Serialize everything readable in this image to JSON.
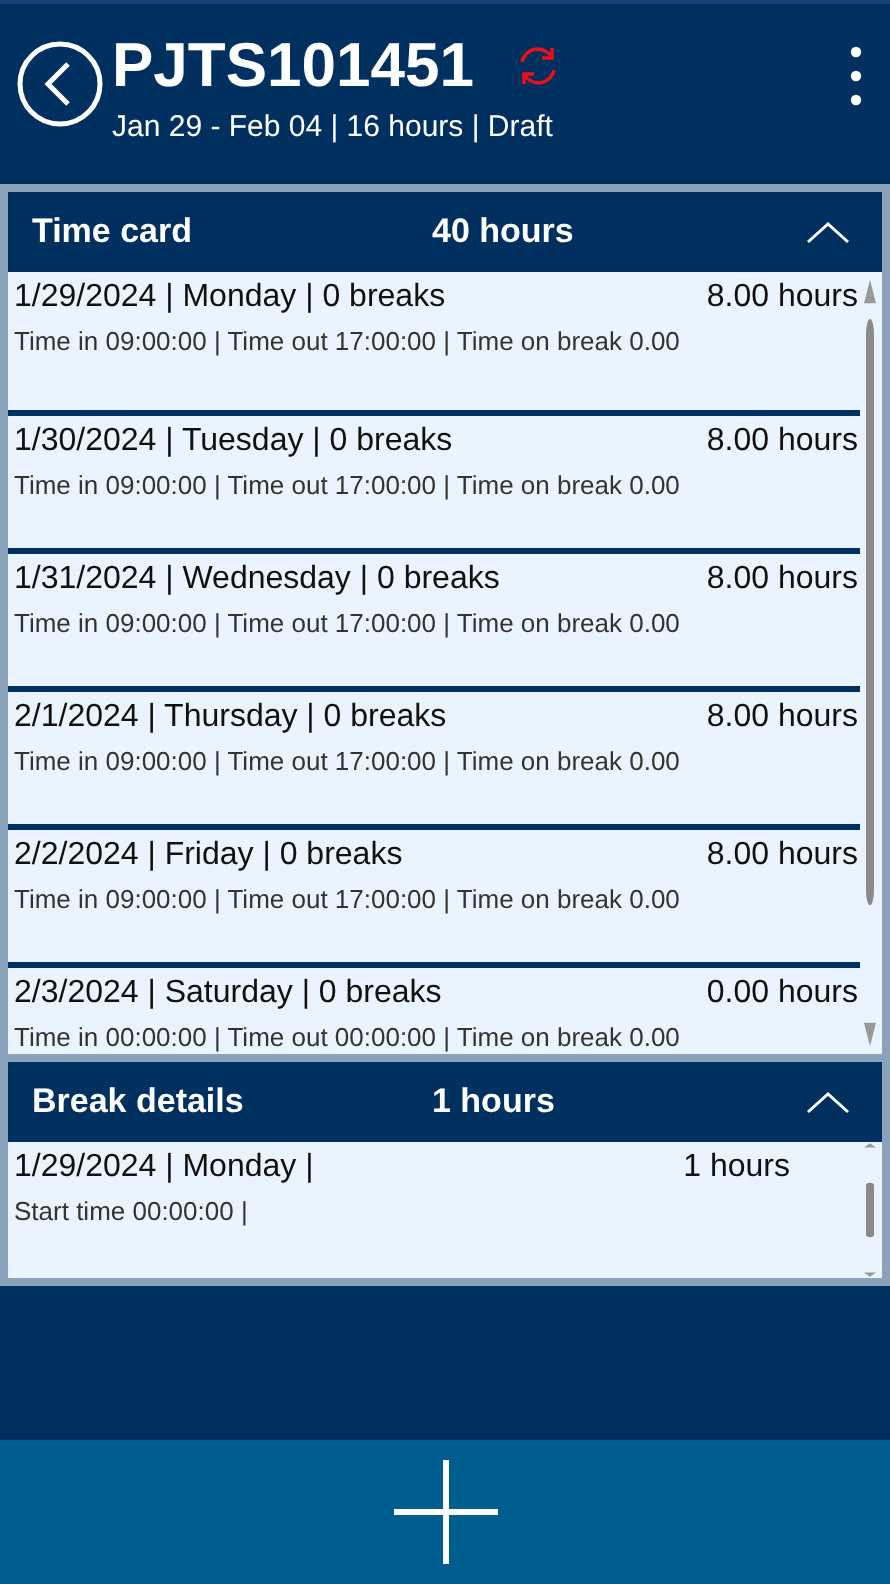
{
  "header": {
    "title": "PJTS101451",
    "subtitle": "Jan 29 - Feb 04 | 16 hours | Draft"
  },
  "time_card": {
    "title": "Time card",
    "total": "40 hours",
    "expanded": true,
    "rows": [
      {
        "line1": "1/29/2024 | Monday | 0 breaks",
        "hours": "8.00 hours",
        "line2": "Time in 09:00:00 | Time out 17:00:00 | Time on break 0.00"
      },
      {
        "line1": "1/30/2024 | Tuesday | 0 breaks",
        "hours": "8.00 hours",
        "line2": "Time in 09:00:00 | Time out 17:00:00 | Time on break 0.00"
      },
      {
        "line1": "1/31/2024 | Wednesday | 0 breaks",
        "hours": "8.00 hours",
        "line2": "Time in 09:00:00 | Time out 17:00:00 | Time on break 0.00"
      },
      {
        "line1": "2/1/2024 | Thursday | 0 breaks",
        "hours": "8.00 hours",
        "line2": "Time in 09:00:00 | Time out 17:00:00 | Time on break 0.00"
      },
      {
        "line1": "2/2/2024 | Friday | 0 breaks",
        "hours": "8.00 hours",
        "line2": "Time in 09:00:00 | Time out 17:00:00 | Time on break 0.00"
      },
      {
        "line1": "2/3/2024 | Saturday | 0 breaks",
        "hours": "0.00 hours",
        "line2": "Time in 00:00:00 | Time out 00:00:00 | Time on break 0.00"
      }
    ]
  },
  "break_details": {
    "title": "Break details",
    "total": "1 hours",
    "expanded": true,
    "rows": [
      {
        "line1": "1/29/2024 | Monday |",
        "hours": "1 hours",
        "line2": "Start time 00:00:00 |"
      }
    ]
  }
}
